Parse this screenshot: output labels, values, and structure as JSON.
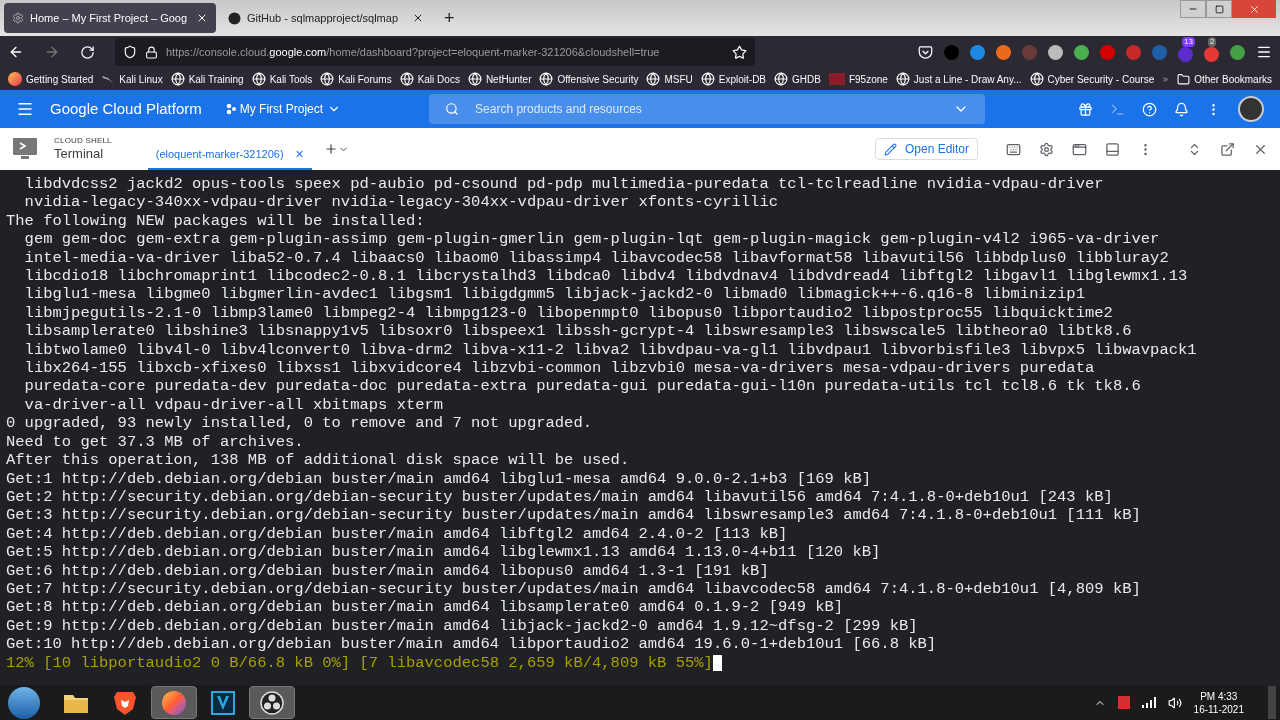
{
  "browser": {
    "tabs": [
      {
        "title": "Home – My First Project – Goog",
        "selected": true
      },
      {
        "title": "GitHub - sqlmapproject/sqlmap",
        "selected": false
      }
    ],
    "new_tab": "+",
    "url": {
      "prefix": "https://console.cloud.",
      "domain": "google.com",
      "path": "/home/dashboard?project=eloquent-marker-321206&cloudshell=true"
    },
    "extension_badges": [
      "13",
      "2"
    ],
    "bookmarks": [
      {
        "label": "Getting Started",
        "kind": "firefox"
      },
      {
        "label": "Kali Linux",
        "kind": "kali"
      },
      {
        "label": "Kali Training",
        "kind": "globe"
      },
      {
        "label": "Kali Tools",
        "kind": "globe"
      },
      {
        "label": "Kali Forums",
        "kind": "globe"
      },
      {
        "label": "Kali Docs",
        "kind": "globe"
      },
      {
        "label": "NetHunter",
        "kind": "globe"
      },
      {
        "label": "Offensive Security",
        "kind": "globe"
      },
      {
        "label": "MSFU",
        "kind": "globe"
      },
      {
        "label": "Exploit-DB",
        "kind": "globe"
      },
      {
        "label": "GHDB",
        "kind": "globe"
      },
      {
        "label": "F95zone",
        "kind": "f95"
      },
      {
        "label": "Just a Line - Draw Any...",
        "kind": "globe"
      },
      {
        "label": "Cyber Security - Course",
        "kind": "globe"
      }
    ],
    "other_bookmarks": "Other Bookmarks"
  },
  "console": {
    "product": "Google Cloud Platform",
    "project": "My First Project",
    "search_placeholder": "Search products and resources"
  },
  "cloud_shell": {
    "section": "CLOUD SHELL",
    "title": "Terminal",
    "tab": "(eloquent-marker-321206)",
    "tab_close": "×",
    "open_editor": "Open Editor"
  },
  "terminal_lines": [
    {
      "text": "  libdvdcss2 jackd2 opus-tools speex pd-aubio pd-csound pd-pdp multimedia-puredata tcl-tclreadline nvidia-vdpau-driver",
      "kind": "output"
    },
    {
      "text": "  nvidia-legacy-340xx-vdpau-driver nvidia-legacy-304xx-vdpau-driver xfonts-cyrillic",
      "kind": "output"
    },
    {
      "text": "The following NEW packages will be installed:",
      "kind": "output"
    },
    {
      "text": "  gem gem-doc gem-extra gem-plugin-assimp gem-plugin-gmerlin gem-plugin-lqt gem-plugin-magick gem-plugin-v4l2 i965-va-driver",
      "kind": "output"
    },
    {
      "text": "  intel-media-va-driver liba52-0.7.4 libaacs0 libaom0 libassimp4 libavcodec58 libavformat58 libavutil56 libbdplus0 libbluray2",
      "kind": "output"
    },
    {
      "text": "  libcdio18 libchromaprint1 libcodec2-0.8.1 libcrystalhd3 libdca0 libdv4 libdvdnav4 libdvdread4 libftgl2 libgavl1 libglewmx1.13",
      "kind": "output"
    },
    {
      "text": "  libglu1-mesa libgme0 libgmerlin-avdec1 libgsm1 libigdgmm5 libjack-jackd2-0 libmad0 libmagick++-6.q16-8 libminizip1",
      "kind": "output"
    },
    {
      "text": "  libmjpegutils-2.1-0 libmp3lame0 libmpeg2-4 libmpg123-0 libopenmpt0 libopus0 libportaudio2 libpostproc55 libquicktime2",
      "kind": "output"
    },
    {
      "text": "  libsamplerate0 libshine3 libsnappy1v5 libsoxr0 libspeex1 libssh-gcrypt-4 libswresample3 libswscale5 libtheora0 libtk8.6",
      "kind": "output"
    },
    {
      "text": "  libtwolame0 libv4l-0 libv4lconvert0 libva-drm2 libva-x11-2 libva2 libvdpau-va-gl1 libvdpau1 libvorbisfile3 libvpx5 libwavpack1",
      "kind": "output"
    },
    {
      "text": "  libx264-155 libxcb-xfixes0 libxss1 libxvidcore4 libzvbi-common libzvbi0 mesa-va-drivers mesa-vdpau-drivers puredata",
      "kind": "output"
    },
    {
      "text": "  puredata-core puredata-dev puredata-doc puredata-extra puredata-gui puredata-gui-l10n puredata-utils tcl tcl8.6 tk tk8.6",
      "kind": "output"
    },
    {
      "text": "  va-driver-all vdpau-driver-all xbitmaps xterm",
      "kind": "output"
    },
    {
      "text": "0 upgraded, 93 newly installed, 0 to remove and 7 not upgraded.",
      "kind": "output"
    },
    {
      "text": "Need to get 37.3 MB of archives.",
      "kind": "output"
    },
    {
      "text": "After this operation, 138 MB of additional disk space will be used.",
      "kind": "output"
    },
    {
      "text": "Get:1 http://deb.debian.org/debian buster/main amd64 libglu1-mesa amd64 9.0.0-2.1+b3 [169 kB]",
      "kind": "output"
    },
    {
      "text": "Get:2 http://security.debian.org/debian-security buster/updates/main amd64 libavutil56 amd64 7:4.1.8-0+deb10u1 [243 kB]",
      "kind": "output"
    },
    {
      "text": "Get:3 http://security.debian.org/debian-security buster/updates/main amd64 libswresample3 amd64 7:4.1.8-0+deb10u1 [111 kB]",
      "kind": "output"
    },
    {
      "text": "Get:4 http://deb.debian.org/debian buster/main amd64 libftgl2 amd64 2.4.0-2 [113 kB]",
      "kind": "output"
    },
    {
      "text": "Get:5 http://deb.debian.org/debian buster/main amd64 libglewmx1.13 amd64 1.13.0-4+b11 [120 kB]",
      "kind": "output"
    },
    {
      "text": "Get:6 http://deb.debian.org/debian buster/main amd64 libopus0 amd64 1.3-1 [191 kB]",
      "kind": "output"
    },
    {
      "text": "Get:7 http://security.debian.org/debian-security buster/updates/main amd64 libavcodec58 amd64 7:4.1.8-0+deb10u1 [4,809 kB]",
      "kind": "output"
    },
    {
      "text": "Get:8 http://deb.debian.org/debian buster/main amd64 libsamplerate0 amd64 0.1.9-2 [949 kB]",
      "kind": "output"
    },
    {
      "text": "Get:9 http://deb.debian.org/debian buster/main amd64 libjack-jackd2-0 amd64 1.9.12~dfsg-2 [299 kB]",
      "kind": "output"
    },
    {
      "text": "Get:10 http://deb.debian.org/debian buster/main amd64 libportaudio2 amd64 19.6.0-1+deb10u1 [66.8 kB]",
      "kind": "output"
    },
    {
      "text": "12% [10 libportaudio2 0 B/66.8 kB 0%] [7 libavcodec58 2,659 kB/4,809 kB 55%]",
      "kind": "progress"
    }
  ],
  "taskbar": {
    "apps": [
      {
        "kind": "files",
        "selected": false
      },
      {
        "kind": "brave",
        "selected": false
      },
      {
        "kind": "firefox",
        "selected": true
      },
      {
        "kind": "vegas",
        "selected": false
      },
      {
        "kind": "obs",
        "selected": true
      }
    ],
    "time": "PM 4:33",
    "date": "16-11-2021"
  }
}
